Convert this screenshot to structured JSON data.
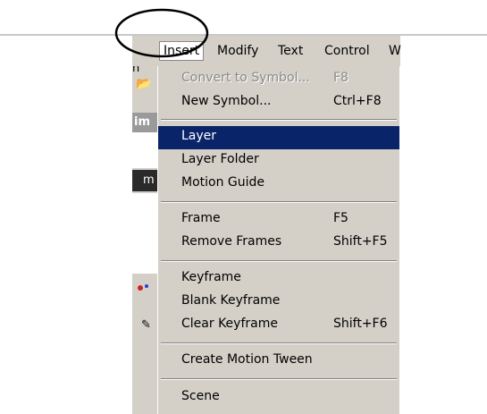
{
  "menubar": {
    "items": [
      {
        "label": "Insert"
      },
      {
        "label": "Modify"
      },
      {
        "label": "Text"
      },
      {
        "label": "Control"
      },
      {
        "label": "W"
      }
    ]
  },
  "strip": {
    "fragment_1": "n",
    "fragment_2": "im",
    "fragment_3": "m"
  },
  "menu": {
    "items": [
      {
        "label": "Convert to Symbol...",
        "shortcut": "F8",
        "state": "disabled"
      },
      {
        "label": "New Symbol...",
        "shortcut": "Ctrl+F8"
      },
      {
        "label": "Layer",
        "shortcut": "",
        "state": "highlighted"
      },
      {
        "label": "Layer Folder",
        "shortcut": ""
      },
      {
        "label": "Motion Guide",
        "shortcut": ""
      },
      {
        "label": "Frame",
        "shortcut": "F5"
      },
      {
        "label": "Remove Frames",
        "shortcut": "Shift+F5"
      },
      {
        "label": "Keyframe",
        "shortcut": ""
      },
      {
        "label": "Blank Keyframe",
        "shortcut": ""
      },
      {
        "label": "Clear Keyframe",
        "shortcut": "Shift+F6"
      },
      {
        "label": "Create Motion Tween",
        "shortcut": ""
      },
      {
        "label": "Scene",
        "shortcut": ""
      }
    ]
  },
  "colors": {
    "menu_bg": "#d4d0c8",
    "highlight": "#0a246a",
    "disabled_text": "#8a8a8a"
  }
}
